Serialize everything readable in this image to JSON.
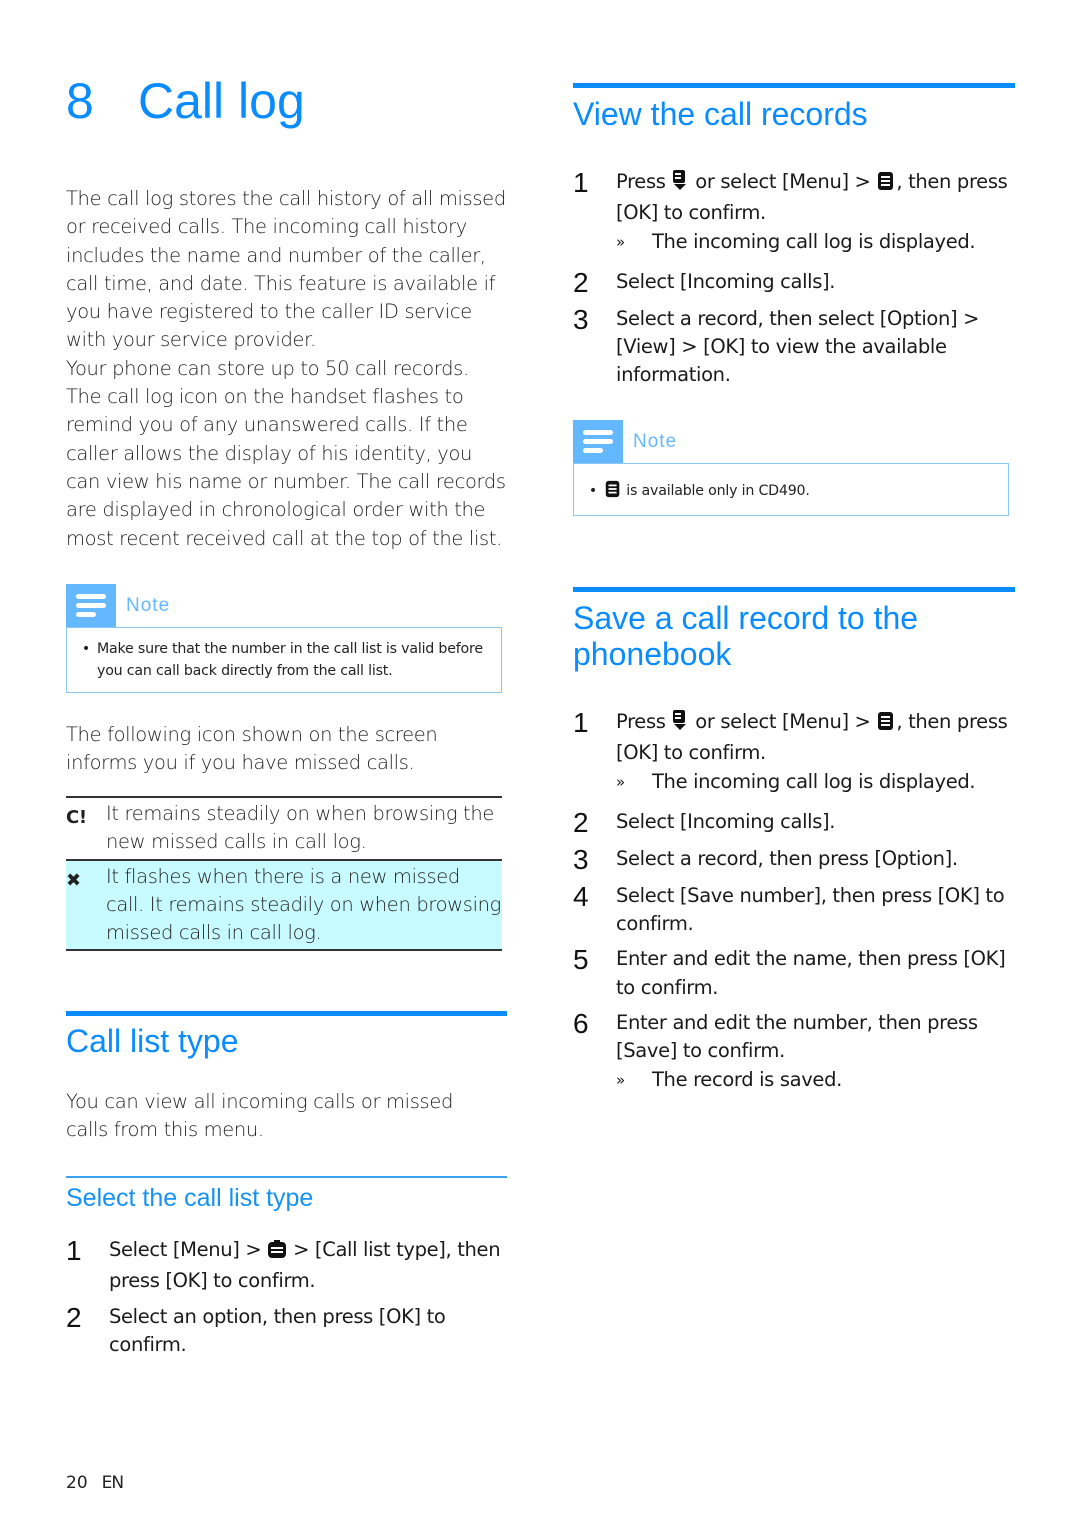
{
  "chapter": {
    "number": "8",
    "title": "Call log"
  },
  "intro": {
    "paragraph1": "The call log stores the call history of all missed or received calls. The incoming call history includes the name and number of the caller, call time, and date. This feature is available if you have registered to the caller ID service with your service provider.",
    "paragraph2": "Your phone can store up to 50 call records. The call log icon on the handset flashes to remind you of any unanswered calls. If the caller allows the display of his identity, you can view his name or number. The call records are displayed in chronological order with the most recent received call at the top of the list."
  },
  "note_left": {
    "title": "Note",
    "items": [
      "Make sure that the number in the call list is valid before you can call back directly from the call list."
    ]
  },
  "icon_intro": "The following icon shown on the screen informs you if you have missed calls.",
  "icon_table": [
    {
      "icon": "missed-call-steady-icon",
      "glyph": "C!",
      "text": "It remains steadily on when browsing the new missed calls in call log.",
      "highlight": false
    },
    {
      "icon": "missed-call-flash-icon",
      "glyph": "✖",
      "text": "It flashes when there is a new missed call. It remains steadily on when browsing missed calls in call log.",
      "highlight": true
    }
  ],
  "call_list_type": {
    "heading": "Call list type",
    "description": "You can view all incoming calls or missed calls from this menu.",
    "subheading": "Select the call list type",
    "steps": [
      {
        "n": "1",
        "pre": "Select [Menu] > ",
        "icon": "call-log-menu-icon",
        "post": " > [Call list type], then press [OK] to confirm."
      },
      {
        "n": "2",
        "text": "Select an option, then press [OK] to confirm."
      }
    ]
  },
  "view_records": {
    "heading": "View the call records",
    "steps": [
      {
        "n": "1",
        "pre": "Press ",
        "icon1": "call-log-key-icon",
        "mid": " or select [Menu] > ",
        "icon2": "call-log-menu-icon",
        "post": ", then press [OK] to confirm.",
        "result": "The incoming call log is displayed."
      },
      {
        "n": "2",
        "text": "Select [Incoming calls]."
      },
      {
        "n": "3",
        "text": "Select a record, then select [Option] > [View] > [OK] to view the available information."
      }
    ]
  },
  "note_right": {
    "title": "Note",
    "icon": "call-log-menu-icon",
    "text": " is available only in CD490."
  },
  "save_record": {
    "heading": "Save a call record to the phonebook",
    "steps": [
      {
        "n": "1",
        "pre": "Press ",
        "icon1": "call-log-key-icon",
        "mid": " or select [Menu] > ",
        "icon2": "call-log-menu-icon",
        "post": ", then press [OK] to confirm.",
        "result": "The incoming call log is displayed."
      },
      {
        "n": "2",
        "text": "Select [Incoming calls]."
      },
      {
        "n": "3",
        "text": "Select a record, then press [Option]."
      },
      {
        "n": "4",
        "text": "Select [Save number], then press [OK] to confirm."
      },
      {
        "n": "5",
        "text": "Enter and edit the name, then press [OK] to confirm."
      },
      {
        "n": "6",
        "text": "Enter and edit the number, then press [Save] to confirm.",
        "result": "The record is saved."
      }
    ]
  },
  "result_marker": "»",
  "bullet_marker": "•",
  "footer": {
    "page": "20",
    "lang": "EN"
  },
  "colors": {
    "accent": "#0a8cff",
    "note": "#64b8ff",
    "highlight": "#c8fbff"
  }
}
